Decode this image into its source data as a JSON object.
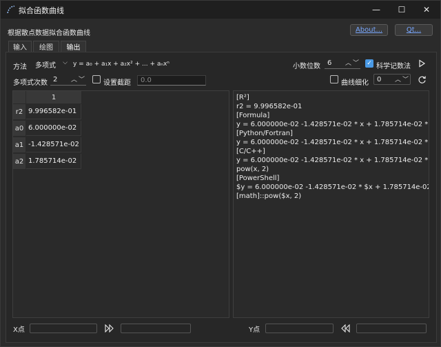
{
  "window": {
    "title": "拟合函数曲线",
    "minimize": "—",
    "maximize": "☐",
    "close": "✕"
  },
  "header": {
    "subtitle": "根据散点数据拟合函数曲线",
    "about_label": "About...",
    "qt_label": "Qt..."
  },
  "tabs": [
    {
      "label": "输入"
    },
    {
      "label": "绘图"
    },
    {
      "label": "输出"
    }
  ],
  "controls": {
    "method_label": "方法",
    "method_value": "多项式",
    "formula": "y = a₀ + a₁x + a₂x² + ... + aₙxⁿ",
    "decimals_label": "小数位数",
    "decimals_value": "6",
    "sci_label": "科学记数法",
    "sci_checked": true,
    "degree_label": "多项式次数",
    "degree_value": "2",
    "intercept_label": "设置截距",
    "intercept_checked": false,
    "intercept_placeholder": "0.0",
    "smooth_label": "曲线细化",
    "smooth_checked": false,
    "smooth_value": "0"
  },
  "table": {
    "column_header": "1",
    "rows": [
      {
        "header": "r2",
        "value": "9.996582e-01"
      },
      {
        "header": "a0",
        "value": "6.000000e-02"
      },
      {
        "header": "a1",
        "value": "-1.428571e-02"
      },
      {
        "header": "a2",
        "value": "1.785714e-02"
      }
    ]
  },
  "output_lines": [
    "[R²]",
    "r2 = 9.996582e-01",
    "[Formula]",
    "y = 6.000000e-02 -1.428571e-02 * x + 1.785714e-02 * x^2",
    "[Python/Fortran]",
    "y = 6.000000e-02 -1.428571e-02 * x + 1.785714e-02 * x**2",
    "[C/C++]",
    "y = 6.000000e-02 -1.428571e-02 * x + 1.785714e-02 *",
    "pow(x, 2)",
    "[PowerShell]",
    "$y = 6.000000e-02 -1.428571e-02 * $x + 1.785714e-02 *",
    "[math]::pow($x, 2)"
  ],
  "footer": {
    "x_label": "X点",
    "y_label": "Y点"
  },
  "icons": {
    "run": "play-icon",
    "refresh": "refresh-icon",
    "forward": "double-right-icon",
    "back": "double-left-icon"
  },
  "colors": {
    "accent": "#4a9ae6",
    "link": "#79a8ff",
    "background": "#2b2b2b"
  }
}
